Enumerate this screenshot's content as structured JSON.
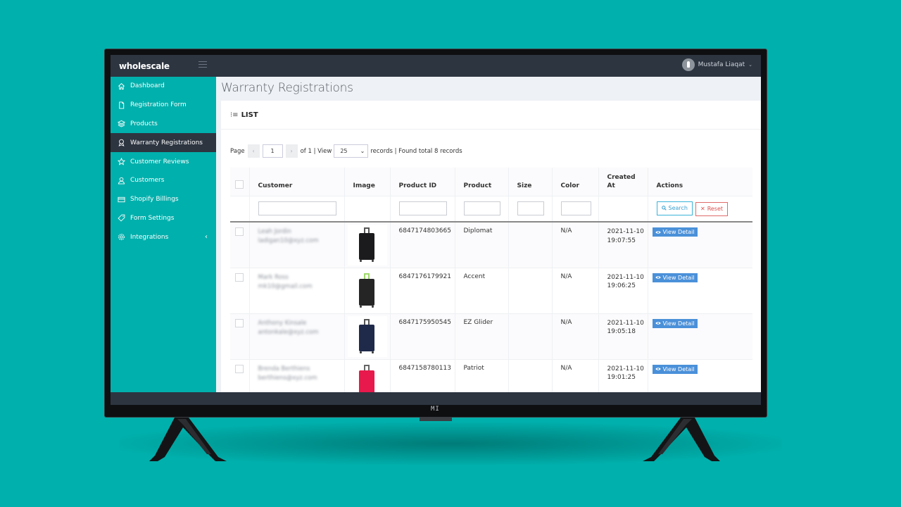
{
  "app": {
    "brand": "wholescale",
    "user_name": "Mustafa Liaqat",
    "tv_logo": "MI"
  },
  "colors": {
    "background": "#00b0ac",
    "sidebar": "#00b0ac",
    "topbar": "#2d3541",
    "active_item": "#2d3541",
    "view_button": "#4a90d9",
    "search_button": "#3aa0d0",
    "reset_button": "#d9534f"
  },
  "sidebar": {
    "items": [
      {
        "label": "Dashboard",
        "icon": "home-icon",
        "active": false
      },
      {
        "label": "Registration Form",
        "icon": "file-icon",
        "active": false
      },
      {
        "label": "Products",
        "icon": "layers-icon",
        "active": false
      },
      {
        "label": "Warranty Registrations",
        "icon": "award-icon",
        "active": true
      },
      {
        "label": "Customer Reviews",
        "icon": "star-icon",
        "active": false
      },
      {
        "label": "Customers",
        "icon": "user-icon",
        "active": false
      },
      {
        "label": "Shopify Billings",
        "icon": "credit-card-icon",
        "active": false
      },
      {
        "label": "Form Settings",
        "icon": "tag-icon",
        "active": false
      },
      {
        "label": "Integrations",
        "icon": "gear-icon",
        "active": false,
        "caret": "‹"
      }
    ]
  },
  "main": {
    "page_title": "Warranty Registrations",
    "card_title": "LIST",
    "pager": {
      "page_label": "Page",
      "prev": "‹",
      "current_page": "1",
      "next": "›",
      "of_text": "of 1 | View",
      "view_value": "25",
      "records_text": "records | Found total 8 records"
    },
    "table": {
      "columns": [
        "",
        "Customer",
        "Image",
        "Product ID",
        "Product",
        "Size",
        "Color",
        "Created At",
        "Actions"
      ],
      "search_label": "Search",
      "reset_label": "Reset",
      "view_label": "View Detail",
      "rows": [
        {
          "customer_name": "Leah Jordin",
          "customer_email": "ladigan10@xyz.com",
          "product_id": "6847174803665",
          "product": "Diplomat",
          "size": "",
          "color": "N/A",
          "created_date": "2021-11-10",
          "created_time": "19:07:55",
          "bag_color": "#1b1b1d",
          "handle_color": "#555555"
        },
        {
          "customer_name": "Mark Ross",
          "customer_email": "mk10@gmail.com",
          "product_id": "6847176179921",
          "product": "Accent",
          "size": "",
          "color": "N/A",
          "created_date": "2021-11-10",
          "created_time": "19:06:25",
          "bag_color": "#252525",
          "handle_color": "#9fd86b"
        },
        {
          "customer_name": "Anthony Kinsale",
          "customer_email": "antonkale@xyz.com",
          "product_id": "6847175950545",
          "product": "EZ Glider",
          "size": "",
          "color": "N/A",
          "created_date": "2021-11-10",
          "created_time": "19:05:18",
          "bag_color": "#1f2a4a",
          "handle_color": "#555555"
        },
        {
          "customer_name": "Brenda Berthiens",
          "customer_email": "berthiens@xyz.com",
          "product_id": "6847158780113",
          "product": "Patriot",
          "size": "",
          "color": "N/A",
          "created_date": "2021-11-10",
          "created_time": "19:01:25",
          "bag_color": "#e8194c",
          "handle_color": "#666666"
        }
      ]
    }
  }
}
